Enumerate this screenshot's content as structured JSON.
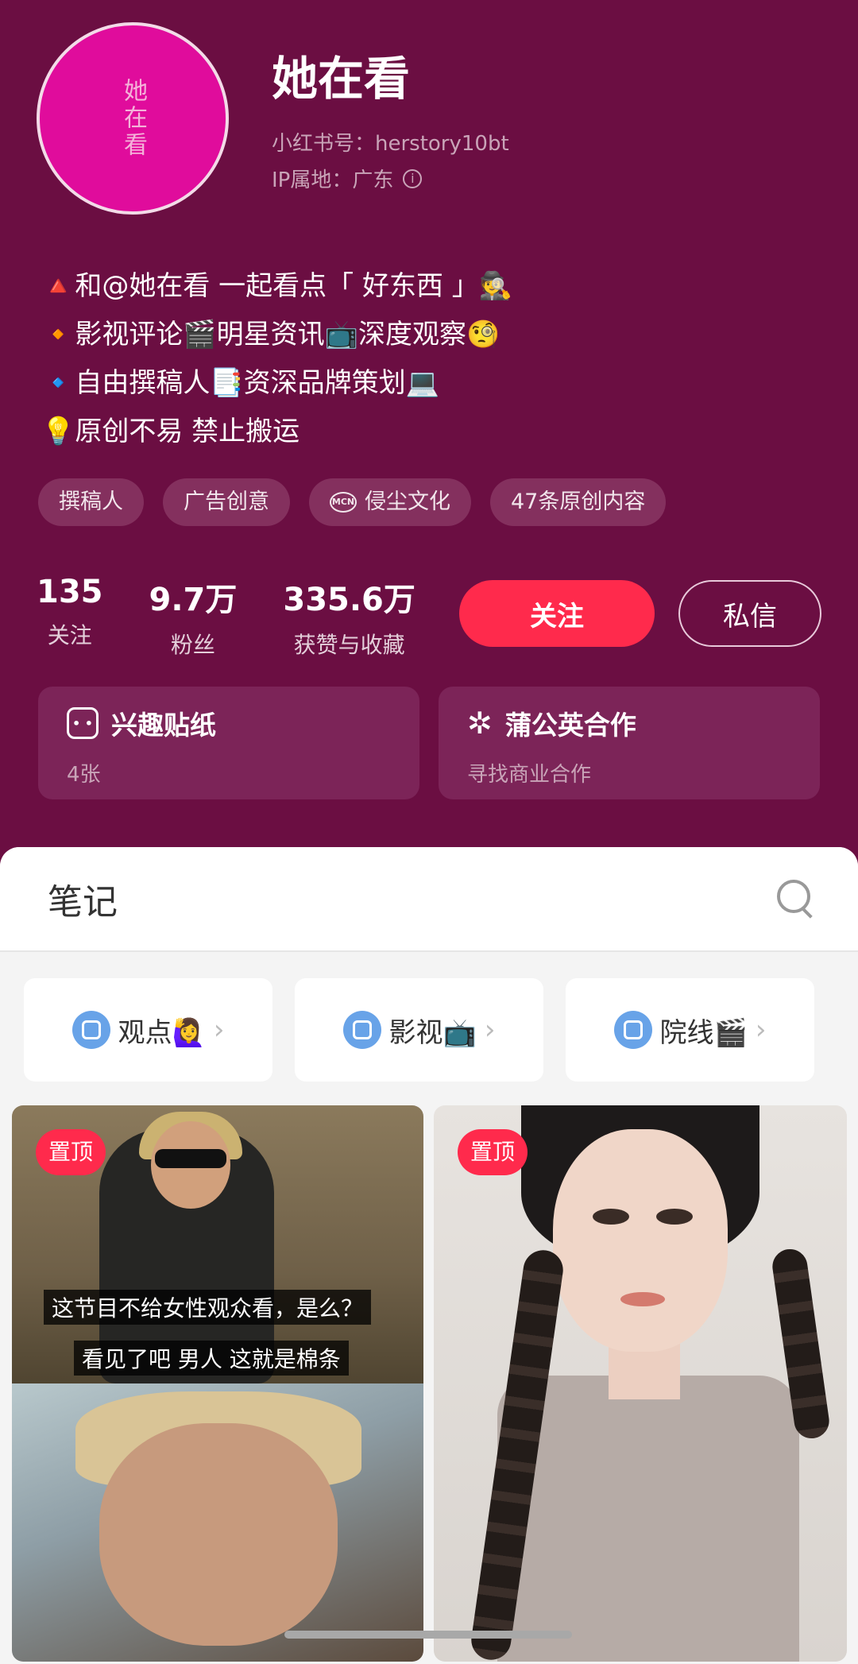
{
  "profile": {
    "avatar_text": "她在看",
    "name": "她在看",
    "xhs_id": "小红书号：herstory10bt",
    "ip_location": "IP属地：广东"
  },
  "bio": [
    "🔺和@她在看 一起看点「 好东西 」🕵️",
    "🔸影视评论🎬明星资讯📺深度观察🧐",
    "🔹自由撰稿人📑资深品牌策划💻",
    "💡原创不易 禁止搬运"
  ],
  "tags": [
    "撰稿人",
    "广告创意",
    "侵尘文化",
    "47条原创内容"
  ],
  "mcn_label": "MCN",
  "stats": [
    {
      "value": "135",
      "label": "关注"
    },
    {
      "value": "9.7万",
      "label": "粉丝"
    },
    {
      "value": "335.6万",
      "label": "获赞与收藏"
    }
  ],
  "buttons": {
    "follow": "关注",
    "message": "私信"
  },
  "cards": [
    {
      "title": "兴趣贴纸",
      "sub": "4张",
      "icon": "sticker-icon"
    },
    {
      "title": "蒲公英合作",
      "sub": "寻找商业合作",
      "icon": "dandelion-icon"
    }
  ],
  "notes": {
    "title": "笔记",
    "collections": [
      "观点🙋‍♀️",
      "影视📺",
      "院线🎬"
    ],
    "posts": [
      {
        "badge": "置顶",
        "subtitles": [
          "这节目不给女性观众看，是么？",
          "看见了吧 男人 这就是棉条"
        ]
      },
      {
        "badge": "置顶"
      }
    ]
  },
  "colors": {
    "background": "#6b0e42",
    "accent": "#ff2a4c",
    "avatar": "#e00c9c"
  }
}
